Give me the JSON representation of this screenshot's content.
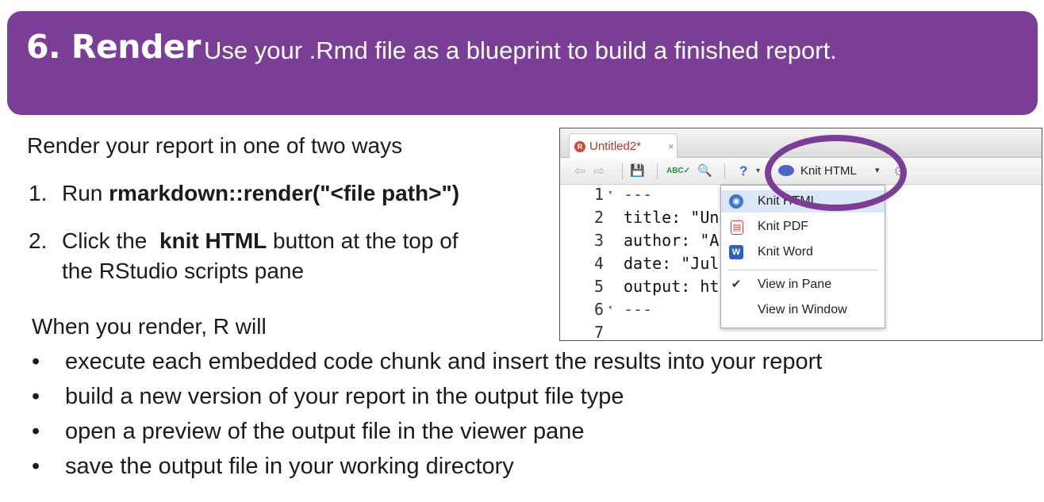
{
  "header": {
    "title": "6. Render",
    "subtitle": "Use your .Rmd file as a blueprint to build a finished report."
  },
  "intro": "Render your report in one of two ways",
  "steps": [
    {
      "num": "1.",
      "pre": "Run ",
      "bold": "rmarkdown::render(\"<file path>\")",
      "post": ""
    },
    {
      "num": "2.",
      "pre": "Click the  ",
      "bold": "knit HTML",
      "post": " button at the top of",
      "line2": "the RStudio scripts pane"
    }
  ],
  "when": "When you render, R will",
  "bullet_char": "•",
  "bullets": [
    "execute each embedded code chunk and insert the results into your report",
    "build a new version of your report in the output file type",
    "open a preview of the output file in the viewer pane",
    "save the output file in your working directory"
  ],
  "rstudio": {
    "tab_icon": "R",
    "tab_name": "Untitled2*",
    "tab_close": "×",
    "toolbar": {
      "back": "⇦",
      "forward": "⇨",
      "save": "💾",
      "spell": "ABC✓",
      "search": "🔍",
      "help": "?",
      "knit_label": "Knit HTML",
      "knit_caret": "▾",
      "gear": "⚙"
    },
    "code_lines": [
      {
        "n": "1",
        "fold": "▾",
        "text": "---",
        "blue": true
      },
      {
        "n": "2",
        "fold": "",
        "text": "title: \"Un",
        "blue": false
      },
      {
        "n": "3",
        "fold": "",
        "text": "author: \"A",
        "blue": false
      },
      {
        "n": "4",
        "fold": "",
        "text": "date: \"Jul",
        "blue": false
      },
      {
        "n": "5",
        "fold": "",
        "text": "output: ht",
        "blue": false
      },
      {
        "n": "6",
        "fold": "▾",
        "text": "---",
        "blue": true
      },
      {
        "n": "7",
        "fold": "",
        "text": "",
        "blue": false
      }
    ],
    "menu": [
      {
        "label": "Knit HTML",
        "icon": "globe-icon",
        "glyph": "◉",
        "color": "#3b78c9",
        "selected": true
      },
      {
        "label": "Knit PDF",
        "icon": "pdf-icon",
        "glyph": "▤",
        "color": "#d33a2c",
        "selected": false
      },
      {
        "label": "Knit Word",
        "icon": "word-icon",
        "glyph": "W",
        "color": "#2b5fb8",
        "selected": false
      },
      {
        "label": "View in Pane",
        "icon": "check-icon",
        "glyph": "✔",
        "color": "#333333",
        "selected": false
      },
      {
        "label": "View in Window",
        "icon": "",
        "glyph": "",
        "color": "#333333",
        "selected": false
      }
    ]
  },
  "colors": {
    "accent": "#7a3e96"
  }
}
